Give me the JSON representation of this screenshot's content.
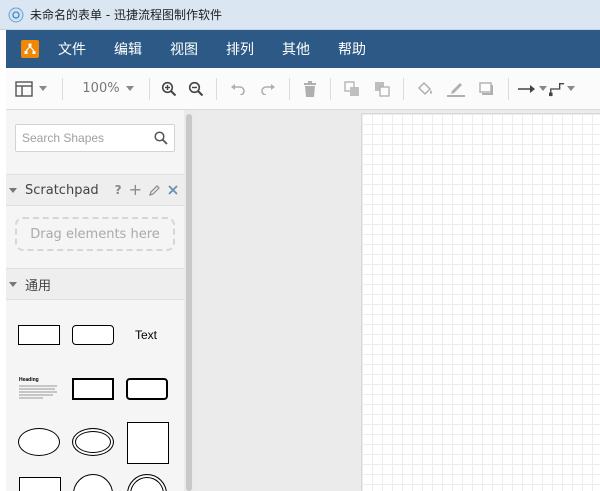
{
  "window": {
    "title": "未命名的表单 - 迅捷流程图制作软件"
  },
  "menu": {
    "items": [
      "文件",
      "编辑",
      "视图",
      "排列",
      "其他",
      "帮助"
    ]
  },
  "toolbar": {
    "zoom": "100%"
  },
  "sidebar": {
    "search_placeholder": "Search Shapes",
    "scratchpad": {
      "label": "Scratchpad",
      "help": "?",
      "add": "+",
      "drop_text": "Drag elements here"
    },
    "general": {
      "label": "通用",
      "text_shape": "Text",
      "heading_shape": "Heading"
    }
  },
  "colors": {
    "menubar": "#2c5986",
    "logo": "#f08705",
    "titlebar": "#dbe6f3"
  }
}
